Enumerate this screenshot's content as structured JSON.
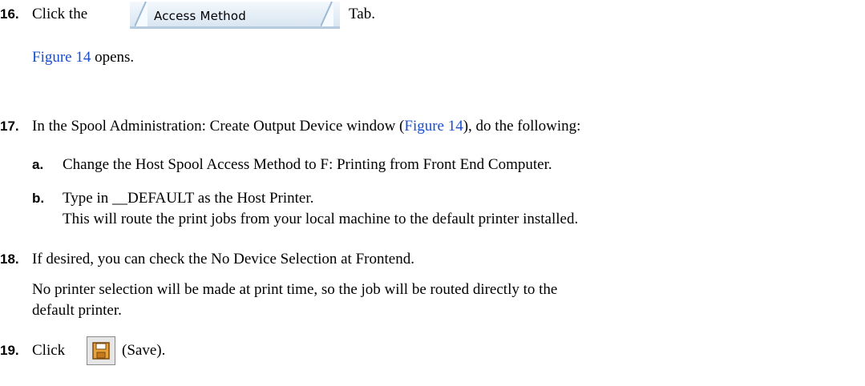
{
  "steps": [
    {
      "num": "16.",
      "pre": "Click the",
      "tab_label": "Access Method",
      "post": "Tab."
    },
    {
      "num": "17.",
      "pre": "In the Spool Administration: Create Output Device window (",
      "link": "Figure 14",
      "post": "), do the following:"
    },
    {
      "num": "18.",
      "text": "If desired, you can check the No Device Selection at Frontend."
    },
    {
      "num": "19.",
      "pre": "Click",
      "post": "(Save)."
    }
  ],
  "step16_result": {
    "link": "Figure 14",
    "text": " opens."
  },
  "step17_subs": [
    {
      "letter": "a.",
      "text": "Change the Host Spool Access Method to F: Printing from Front End Computer."
    },
    {
      "letter": "b.",
      "text": "Type in __DEFAULT as the Host Printer.",
      "note": "This will route the print jobs from your local machine to the default printer installed."
    }
  ],
  "step18_note": {
    "line1": "No printer selection will be made at print time, so the job will be routed directly to the",
    "line2": "default printer."
  },
  "colors": {
    "link": "#1a4fd1",
    "tab_bg": "#d9e6f2",
    "save_icon": "#e8a23a"
  },
  "icons": {
    "save": "floppy-disk-icon"
  }
}
